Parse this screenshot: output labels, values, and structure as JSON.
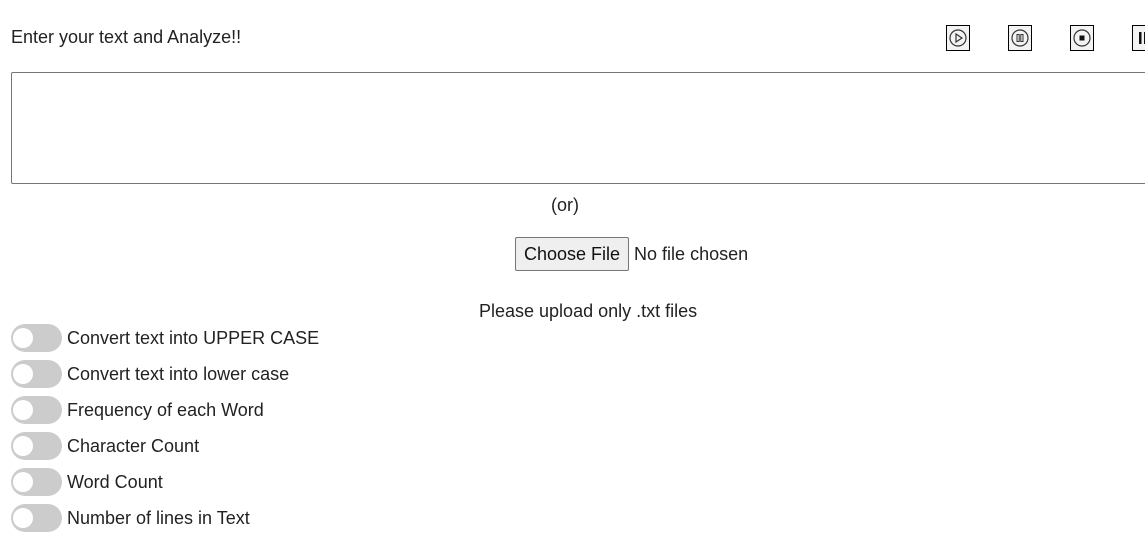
{
  "heading": "Enter your text and Analyze!!",
  "media_controls": [
    {
      "name": "play-button",
      "icon": "play-icon"
    },
    {
      "name": "pause-button",
      "icon": "pause-icon"
    },
    {
      "name": "stop-button",
      "icon": "stop-icon"
    },
    {
      "name": "extra-button",
      "icon": "pause-bars-icon"
    }
  ],
  "textarea": {
    "value": "",
    "placeholder": ""
  },
  "or_text": "(or)",
  "file_input": {
    "button_label": "Choose File",
    "status": "No file chosen"
  },
  "upload_hint": "Please upload only .txt files",
  "options": [
    {
      "label": "Convert text into UPPER CASE",
      "checked": false
    },
    {
      "label": "Convert text into lower case",
      "checked": false
    },
    {
      "label": "Frequency of each Word",
      "checked": false
    },
    {
      "label": "Character Count",
      "checked": false
    },
    {
      "label": "Word Count",
      "checked": false
    },
    {
      "label": "Number of lines in Text",
      "checked": false
    }
  ],
  "colors": {
    "toggle_off": "#cccccc",
    "text": "#222222",
    "button_bg": "#efefef"
  }
}
